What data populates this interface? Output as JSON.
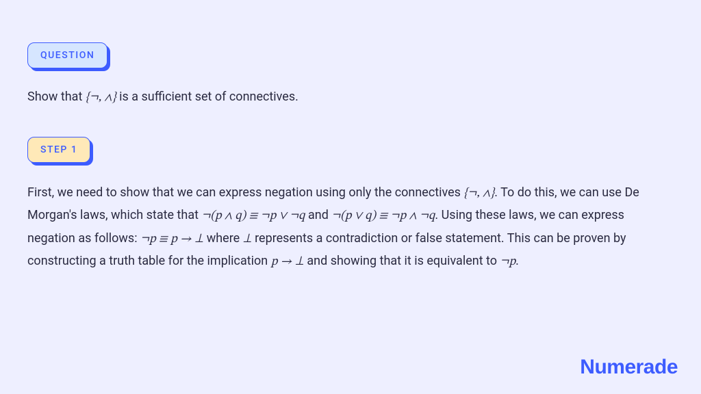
{
  "badges": {
    "question_label": "QUESTION",
    "step_label": "STEP 1"
  },
  "question": {
    "pre": "Show that ",
    "set": "{¬, ∧}",
    "post": " is a sufficient set of connectives."
  },
  "step1": {
    "s1a": "First, we need to show that we can express negation using only the connectives  ",
    "s1_set": "{¬, ∧}",
    "s1b": ". To do this, we can use De Morgan's laws, which state that ",
    "dm1": "¬(p ∧ q) ≡ ¬p ∨ ¬q",
    "s1c": " and ",
    "dm2": "¬(p ∨ q) ≡ ¬p ∧ ¬q",
    "s1d": ". Using these laws, we can express negation as follows: ",
    "neg_expr": "¬p ≡ p → ⊥",
    "s1e": " where ",
    "bot": "⊥",
    "s1f": " represents a contradiction or false statement. This can be proven by constructing a truth table for the implication ",
    "impl": "p → ⊥",
    "s1g": " and showing that it is equivalent to ",
    "notp": "¬p",
    "s1h": "."
  },
  "brand": "Numerade"
}
